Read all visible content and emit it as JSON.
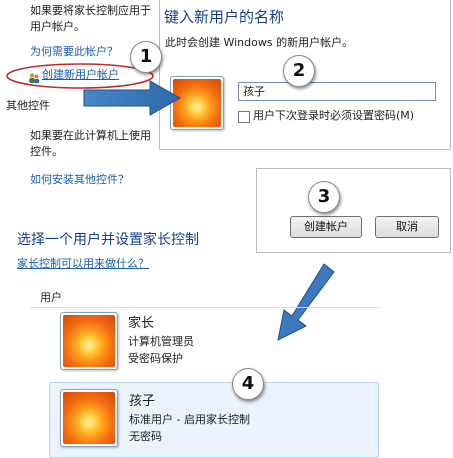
{
  "left_panel": {
    "line1": "如果要将家长控制应用于",
    "line2": "用户帐户。",
    "why_link": "为何需要此帐户？",
    "create_link": "创建新用户帐户",
    "other_controls": "其他控件",
    "other_line1": "如果要在此计算机上使用",
    "other_line2": "控件。",
    "install_link": "如何安装其他控件？"
  },
  "name_dialog": {
    "title": "键入新用户的名称",
    "subtitle": "此时会创建 Windows 的新用户帐户。",
    "name_value": "孩子",
    "require_password_label": "用户下次登录时必须设置密码(M)"
  },
  "buttons": {
    "create": "创建帐户",
    "cancel": "取消"
  },
  "select_section": {
    "title": "选择一个用户并设置家长控制",
    "help_link": "家长控制可以用来做什么？",
    "users_header": "用户"
  },
  "users": [
    {
      "name": "家长",
      "line1": "计算机管理员",
      "line2": "受密码保护"
    },
    {
      "name": "孩子",
      "line1": "标准用户 - 启用家长控制",
      "line2": "无密码"
    }
  ],
  "callouts": [
    "1",
    "2",
    "3",
    "4"
  ]
}
